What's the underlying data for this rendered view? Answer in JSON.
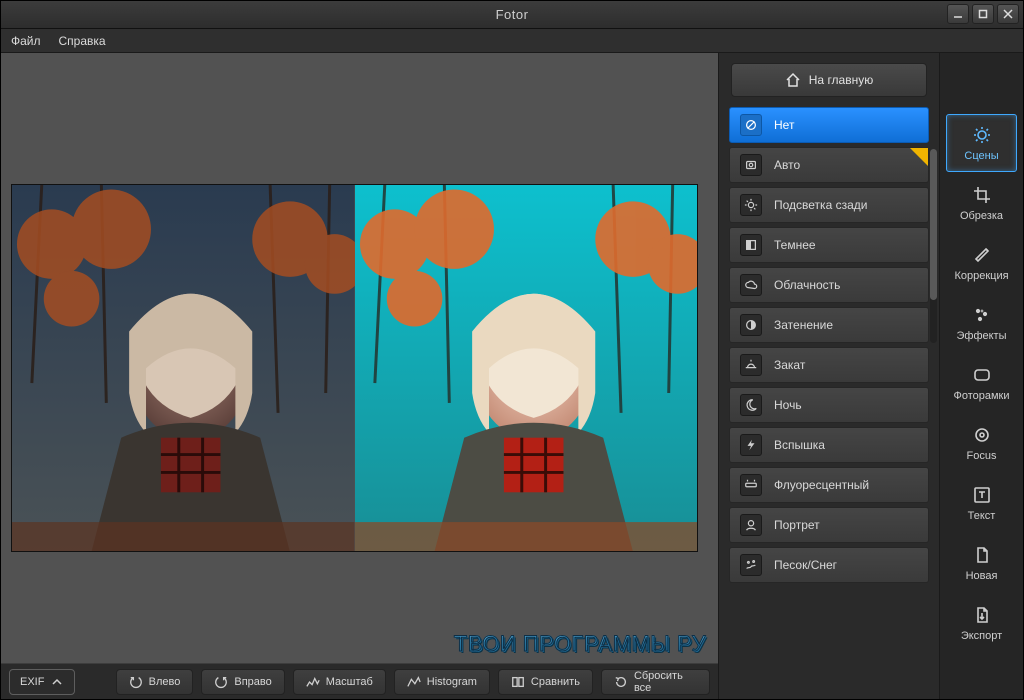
{
  "titlebar": {
    "title": "Fotor"
  },
  "menubar": {
    "file": "Файл",
    "help": "Справка"
  },
  "home_button": "На главную",
  "scenes": {
    "items": [
      {
        "id": "none",
        "label": "Нет"
      },
      {
        "id": "auto",
        "label": "Авто",
        "flag": true
      },
      {
        "id": "backlit",
        "label": "Подсветка сзади"
      },
      {
        "id": "darken",
        "label": "Темнее"
      },
      {
        "id": "cloudy",
        "label": "Облачность"
      },
      {
        "id": "shade",
        "label": "Затенение"
      },
      {
        "id": "sunset",
        "label": "Закат"
      },
      {
        "id": "night",
        "label": "Ночь"
      },
      {
        "id": "flash",
        "label": "Вспышка"
      },
      {
        "id": "fluorescent",
        "label": "Флуоресцентный"
      },
      {
        "id": "portrait",
        "label": "Портрет"
      },
      {
        "id": "sand_snow",
        "label": "Песок/Снег"
      }
    ],
    "active": 0
  },
  "toolstrip": {
    "items": [
      {
        "id": "scenes",
        "label": "Сцены"
      },
      {
        "id": "crop",
        "label": "Обрезка"
      },
      {
        "id": "adjust",
        "label": "Коррекция"
      },
      {
        "id": "effects",
        "label": "Эффекты"
      },
      {
        "id": "frames",
        "label": "Фоторамки"
      },
      {
        "id": "focus",
        "label": "Focus"
      },
      {
        "id": "text",
        "label": "Текст"
      },
      {
        "id": "new",
        "label": "Новая"
      },
      {
        "id": "export",
        "label": "Экспорт"
      }
    ],
    "active": 0
  },
  "toolbar": {
    "exif": "EXIF",
    "rotate_left": "Влево",
    "rotate_right": "Вправо",
    "zoom": "Масштаб",
    "histogram": "Histogram",
    "compare": "Сравнить",
    "reset": "Сбросить все"
  },
  "watermark": "ТВОИ ПРОГРАММЫ РУ"
}
